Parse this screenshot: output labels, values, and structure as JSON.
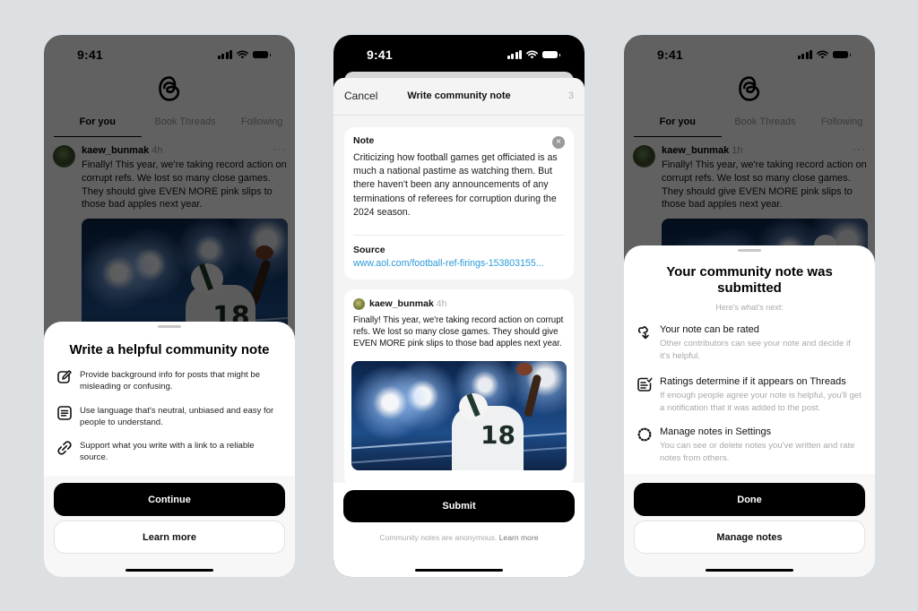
{
  "status_bar": {
    "time": "9:41"
  },
  "feed": {
    "tabs": [
      "For you",
      "Book Threads",
      "Following"
    ],
    "active_tab": "For you",
    "post": {
      "username": "kaew_bunmak",
      "time_phone1": "4h",
      "time_phone3": "1h",
      "more": "···",
      "text": "Finally! This year, we're taking record action on corrupt refs. We lost so many close games. They should give EVEN MORE pink slips to those bad apples next year.",
      "jersey_number": "18"
    }
  },
  "screen1": {
    "title": "Write a helpful community note",
    "tips": [
      {
        "icon": "edit-icon",
        "text": "Provide background info for posts that might be misleading or confusing."
      },
      {
        "icon": "document-icon",
        "text": "Use language that's neutral, unbiased and easy for people to understand."
      },
      {
        "icon": "link-icon",
        "text": "Support what you write with a link to a reliable source."
      }
    ],
    "continue_label": "Continue",
    "learn_more_label": "Learn more"
  },
  "screen2": {
    "cancel_label": "Cancel",
    "title": "Write community note",
    "count": "3",
    "note_label": "Note",
    "note_text": "Criticizing how football games get officiated is as much a national pastime as watching them. But there haven't been any announcements of any terminations of referees for corruption during the 2024 season.",
    "source_label": "Source",
    "source_url": "www.aol.com/football-ref-firings-153803155...",
    "quoted_post": {
      "username": "kaew_bunmak",
      "time": "4h",
      "text": "Finally! This year, we're taking record action on corrupt refs. We lost so many close games. They should give EVEN MORE pink slips to those bad apples next year."
    },
    "submit_label": "Submit",
    "anonymous_text": "Community notes are anonymous.",
    "anonymous_link": "Learn more"
  },
  "screen3": {
    "title": "Your community note was submitted",
    "subtitle": "Here's what's next:",
    "steps": [
      {
        "icon": "rate-icon",
        "title": "Your note can be rated",
        "desc": "Other contributors can see your note and decide if it's helpful."
      },
      {
        "icon": "checklist-icon",
        "title": "Ratings determine if it appears on Threads",
        "desc": "If enough people agree your note is helpful, you'll get a notification that it was added to the post."
      },
      {
        "icon": "settings-icon",
        "title": "Manage notes in Settings",
        "desc": "You can see or delete notes you've written and rate notes from others."
      }
    ],
    "done_label": "Done",
    "manage_label": "Manage notes"
  },
  "colors": {
    "background": "#dde0e3",
    "primary_button": "#000000",
    "link": "#2a9ad8",
    "muted_text": "#a8a8a8"
  }
}
